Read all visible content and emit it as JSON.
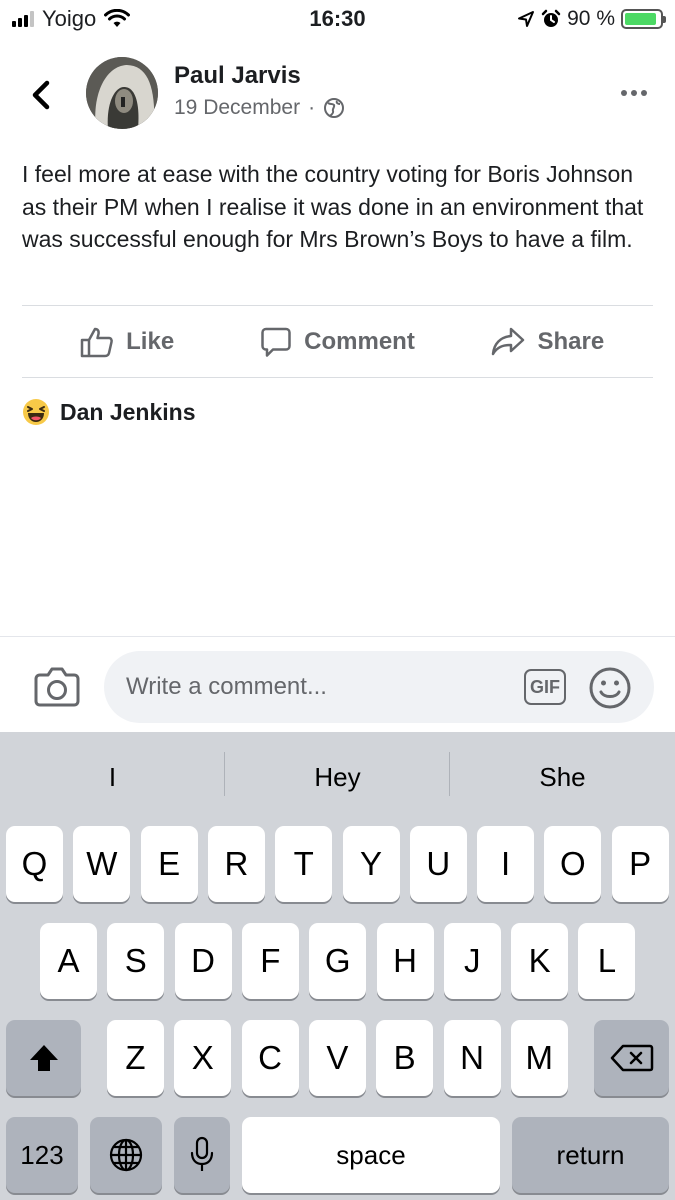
{
  "status_bar": {
    "carrier": "Yoigo",
    "time": "16:30",
    "battery": "90 %",
    "battery_level": 0.9,
    "icons": [
      "signal-icon",
      "wifi-icon",
      "location-arrow-icon",
      "alarm-icon",
      "battery-charging-icon"
    ]
  },
  "post": {
    "author": "Paul Jarvis",
    "date": "19 December",
    "separator": "·",
    "privacy_icon": "globe-icon",
    "text": "I feel more at ease with the country voting for Boris Johnson as their PM when I realise it was done in an environment that was successful enough for Mrs Brown’s Boys to have a film."
  },
  "actions": {
    "like": "Like",
    "comment": "Comment",
    "share": "Share"
  },
  "reactions": {
    "emoji": "😆",
    "name": "Dan Jenkins"
  },
  "composer": {
    "placeholder": "Write a comment...",
    "gif_label": "GIF"
  },
  "keyboard": {
    "suggestions": [
      "I",
      "Hey",
      "She"
    ],
    "row1": [
      "Q",
      "W",
      "E",
      "R",
      "T",
      "Y",
      "U",
      "I",
      "O",
      "P"
    ],
    "row2": [
      "A",
      "S",
      "D",
      "F",
      "G",
      "H",
      "J",
      "K",
      "L"
    ],
    "row3": [
      "Z",
      "X",
      "C",
      "V",
      "B",
      "N",
      "M"
    ],
    "numbers_label": "123",
    "space_label": "space",
    "return_label": "return"
  },
  "colors": {
    "secondary_text": "#65676b",
    "keyboard_bg": "#d1d4d9",
    "battery_green": "#4cd964"
  }
}
